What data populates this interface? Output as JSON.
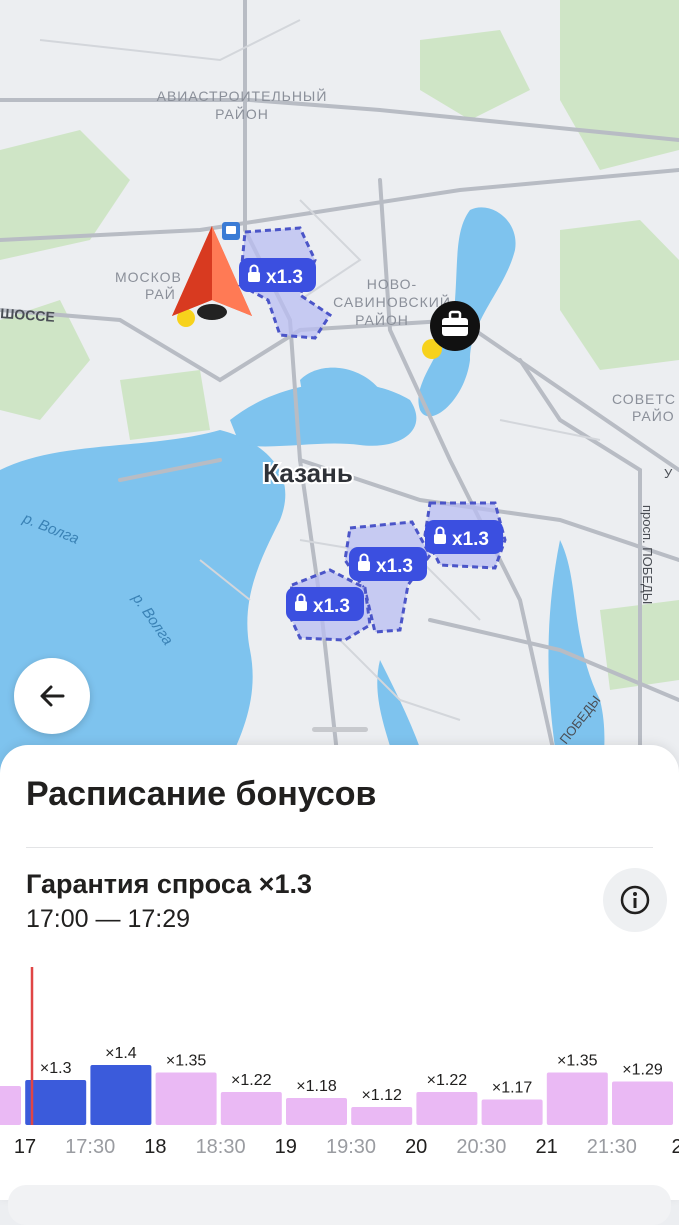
{
  "map": {
    "districts": [
      "АВИАСТРОИТЕЛЬНЫЙ",
      "РАЙОН",
      "МОСКОВ",
      "РАЙ",
      "НОВО-",
      "САВИНОВСКИЙ",
      "РАЙОН",
      "СОВЕТС",
      "РАЙО"
    ],
    "city": "Казань",
    "road_labels": [
      "ШОССЕ",
      "просп. ПОБЕДЫ",
      "ПОБЕДЫ",
      "У"
    ],
    "river_labels": [
      "р. Волга",
      "р. Волга"
    ],
    "zone_badges": [
      "x1.3",
      "x1.3",
      "x1.3",
      "x1.3"
    ],
    "colors": {
      "zone_fill": "#b9bdf2",
      "zone_stroke": "#4b55c8",
      "badge": "#3b4fe0",
      "water": "#7ec3ee"
    }
  },
  "icons": {
    "back": "arrow-left-icon",
    "info": "info-icon",
    "location": "navigation-arrow-icon",
    "work": "briefcase-icon",
    "lock": "lock-icon"
  },
  "sheet": {
    "title": "Расписание бонусов",
    "bonus_title": "Гарантия спроса ×1.3",
    "time_range": "17:00 — 17:29"
  },
  "chart_data": {
    "type": "bar",
    "categories": [
      "16:30",
      "17:00",
      "17:30",
      "18:00",
      "18:30",
      "19:00",
      "19:30",
      "20:00",
      "20:30",
      "21:00",
      "21:30"
    ],
    "values": [
      1.26,
      1.3,
      1.4,
      1.35,
      1.22,
      1.18,
      1.12,
      1.22,
      1.17,
      1.35,
      1.29
    ],
    "bar_labels": [
      "26",
      "×1.3",
      "×1.4",
      "×1.35",
      "×1.22",
      "×1.18",
      "×1.12",
      "×1.22",
      "×1.17",
      "×1.35",
      "×1.29"
    ],
    "highlighted": [
      false,
      true,
      true,
      false,
      false,
      false,
      false,
      false,
      false,
      false,
      false
    ],
    "x_tick_labels": [
      "17",
      "17:30",
      "18",
      "18:30",
      "19",
      "19:30",
      "20",
      "20:30",
      "21",
      "21:30",
      "2"
    ],
    "colors": {
      "active": "#3b5bdb",
      "inactive": "#eab9f4",
      "current_time": "#e04545"
    }
  }
}
